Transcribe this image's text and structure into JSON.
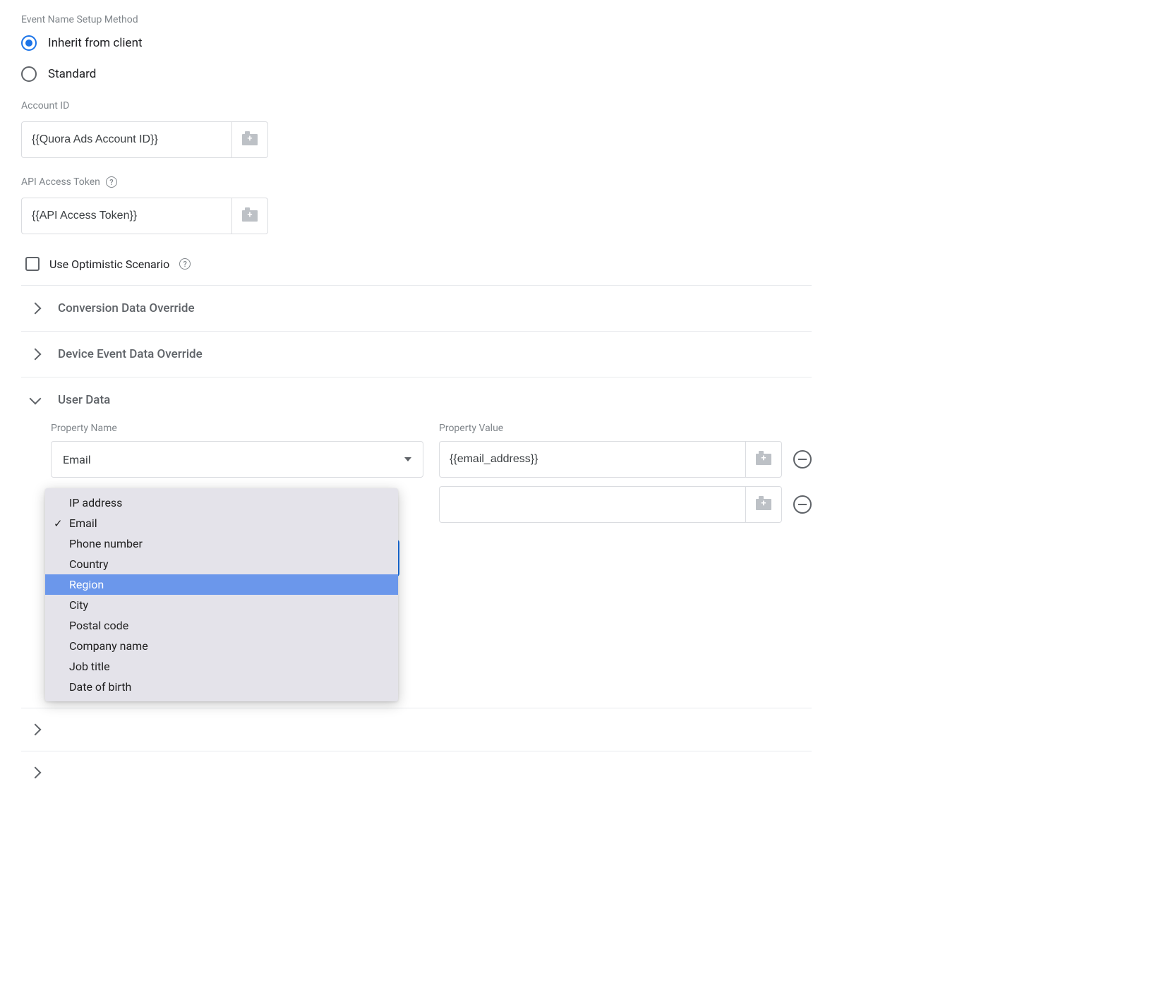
{
  "setupMethod": {
    "label": "Event Name Setup Method",
    "options": {
      "inherit": "Inherit from client",
      "standard": "Standard"
    }
  },
  "accountId": {
    "label": "Account ID",
    "value": "{{Quora Ads Account ID}}"
  },
  "apiToken": {
    "label": "API Access Token",
    "value": "{{API Access Token}}"
  },
  "optimistic": {
    "label": "Use Optimistic Scenario"
  },
  "accordions": {
    "conversion": "Conversion Data Override",
    "device": "Device Event Data Override",
    "userData": "User Data"
  },
  "userData": {
    "propertyNameLabel": "Property Name",
    "propertyValueLabel": "Property Value",
    "rows": [
      {
        "name": "Email",
        "value": "{{email_address}}"
      },
      {
        "name": "",
        "value": ""
      }
    ],
    "dropdownOptions": [
      "IP address",
      "Email",
      "Phone number",
      "Country",
      "Region",
      "City",
      "Postal code",
      "Company name",
      "Job title",
      "Date of birth"
    ],
    "selectedOption": "Email",
    "highlightedOption": "Region"
  }
}
